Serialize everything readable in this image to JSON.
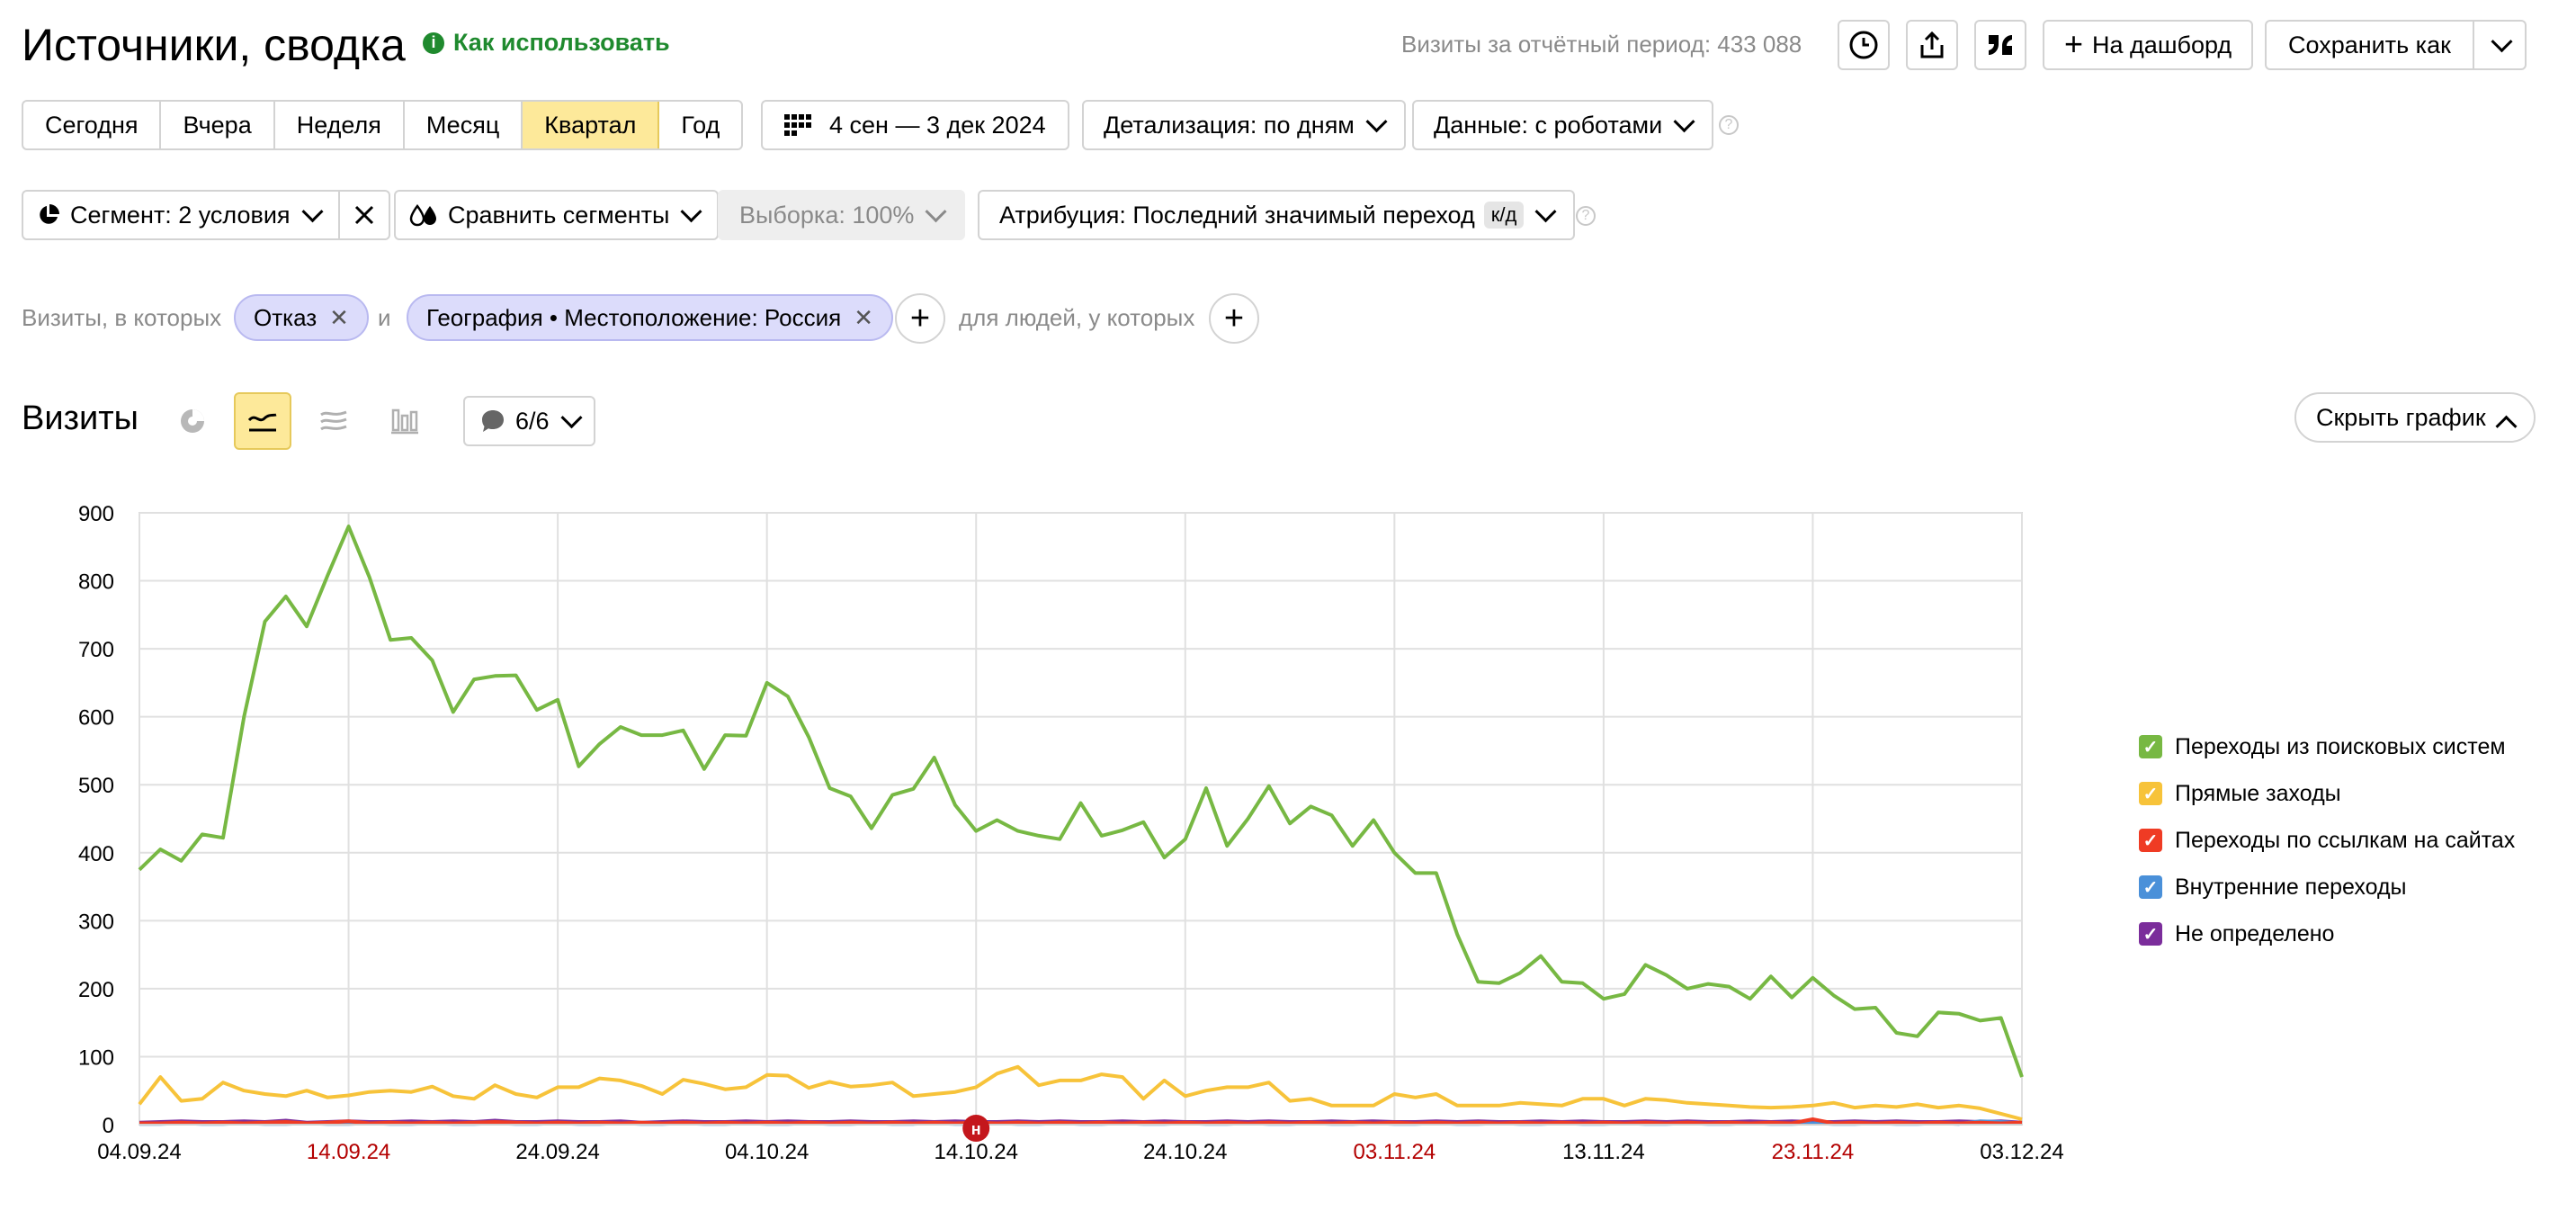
{
  "header": {
    "title": "Источники, сводка",
    "help_link": "Как использовать",
    "visits_summary": "Визиты за отчётный период: 433 088",
    "to_dashboard": "На дашборд",
    "save_as": "Сохранить как"
  },
  "periods": [
    {
      "label": "Сегодня",
      "active": false
    },
    {
      "label": "Вчера",
      "active": false
    },
    {
      "label": "Неделя",
      "active": false
    },
    {
      "label": "Месяц",
      "active": false
    },
    {
      "label": "Квартал",
      "active": true
    },
    {
      "label": "Год",
      "active": false
    }
  ],
  "date_range": "4 сен — 3 дек 2024",
  "detail": "Детализация: по дням",
  "data_mode": "Данные: с роботами",
  "segment": "Сегмент: 2 условия",
  "compare": "Сравнить сегменты",
  "sample": "Выборка: 100%",
  "attribution": "Атрибуция: Последний значимый переход",
  "attribution_badge": "к/д",
  "filters": {
    "prefix": "Визиты, в которых",
    "chip1": "Отказ",
    "conj": "и",
    "chip2": "География • Местоположение: Россия",
    "people": "для людей, у которых"
  },
  "chart_header": {
    "title": "Визиты",
    "series_count": "6/6",
    "hide": "Скрыть график"
  },
  "colors": {
    "accent": "#fde99a",
    "search": "#77b843",
    "direct": "#f7c33a",
    "links": "#ef3b24",
    "internal": "#4a90d9",
    "undefined": "#7b2d9b",
    "weekend": "#b30000"
  },
  "chart_data": {
    "type": "line",
    "ylim": [
      0,
      900
    ],
    "yticks": [
      0,
      100,
      200,
      300,
      400,
      500,
      600,
      700,
      800,
      900
    ],
    "xticks": [
      {
        "label": "04.09.24",
        "weekend": false
      },
      {
        "label": "14.09.24",
        "weekend": true
      },
      {
        "label": "24.09.24",
        "weekend": false
      },
      {
        "label": "04.10.24",
        "weekend": false
      },
      {
        "label": "14.10.24",
        "weekend": false
      },
      {
        "label": "24.10.24",
        "weekend": false
      },
      {
        "label": "03.11.24",
        "weekend": true
      },
      {
        "label": "13.11.24",
        "weekend": false
      },
      {
        "label": "23.11.24",
        "weekend": true
      },
      {
        "label": "03.12.24",
        "weekend": false
      }
    ],
    "marker": {
      "label": "н",
      "day_index": 40
    },
    "series": [
      {
        "name": "Переходы из поисковых систем",
        "color": "#77b843",
        "values": [
          375,
          405,
          388,
          427,
          422,
          600,
          740,
          777,
          733,
          808,
          880,
          805,
          713,
          716,
          683,
          607,
          655,
          660,
          661,
          610,
          625,
          527,
          560,
          585,
          573,
          573,
          580,
          523,
          573,
          572,
          650,
          630,
          570,
          495,
          483,
          436,
          485,
          494,
          540,
          470,
          432,
          448,
          432,
          425,
          420,
          473,
          425,
          433,
          445,
          393,
          420,
          495,
          410,
          450,
          498,
          443,
          468,
          455,
          410,
          448,
          400,
          370,
          370,
          280,
          210,
          208,
          223,
          248,
          210,
          208,
          185,
          192,
          235,
          220,
          200,
          207,
          203,
          185,
          218,
          187,
          216,
          190,
          170,
          172,
          135,
          130,
          165,
          163,
          153,
          157,
          70
        ]
      },
      {
        "name": "Прямые заходы",
        "color": "#f7c33a",
        "values": [
          30,
          70,
          35,
          38,
          62,
          50,
          45,
          42,
          50,
          40,
          43,
          48,
          50,
          48,
          56,
          42,
          38,
          58,
          45,
          40,
          55,
          55,
          68,
          65,
          57,
          45,
          66,
          60,
          52,
          55,
          73,
          72,
          54,
          63,
          56,
          58,
          62,
          42,
          45,
          48,
          55,
          75,
          85,
          58,
          65,
          65,
          74,
          70,
          38,
          65,
          42,
          50,
          55,
          55,
          62,
          35,
          38,
          28,
          28,
          28,
          45,
          40,
          45,
          28,
          28,
          28,
          32,
          30,
          28,
          38,
          38,
          28,
          38,
          36,
          32,
          30,
          28,
          26,
          25,
          26,
          28,
          32,
          25,
          28,
          26,
          30,
          25,
          28,
          24,
          16,
          8
        ]
      },
      {
        "name": "Переходы по ссылкам на сайтах",
        "color": "#ef3b24",
        "values": [
          2,
          2,
          3,
          2,
          3,
          2,
          3,
          4,
          2,
          3,
          5,
          2,
          3,
          2,
          3,
          2,
          3,
          4,
          3,
          2,
          3,
          2,
          3,
          2,
          3,
          2,
          3,
          2,
          3,
          2,
          3,
          2,
          3,
          2,
          3,
          2,
          3,
          2,
          3,
          2,
          3,
          2,
          3,
          2,
          3,
          2,
          3,
          2,
          3,
          2,
          3,
          2,
          3,
          2,
          3,
          2,
          3,
          2,
          3,
          2,
          3,
          2,
          3,
          2,
          3,
          2,
          3,
          2,
          3,
          2,
          3,
          2,
          3,
          2,
          3,
          2,
          3,
          2,
          3,
          2,
          8,
          2,
          3,
          2,
          3,
          2,
          3,
          2,
          3,
          2,
          3
        ]
      },
      {
        "name": "Внутренние переходы",
        "color": "#4a90d9",
        "values": [
          1,
          1,
          2,
          1,
          1,
          2,
          1,
          1,
          2,
          1,
          1,
          2,
          1,
          1,
          2,
          1,
          1,
          2,
          1,
          1,
          2,
          1,
          1,
          2,
          1,
          1,
          2,
          1,
          1,
          2,
          1,
          1,
          2,
          1,
          1,
          2,
          1,
          1,
          2,
          1,
          1,
          2,
          1,
          1,
          2,
          1,
          1,
          2,
          1,
          1,
          2,
          1,
          1,
          2,
          1,
          1,
          2,
          1,
          1,
          2,
          1,
          1,
          2,
          1,
          1,
          2,
          1,
          1,
          2,
          1,
          1,
          2,
          1,
          1,
          2,
          1,
          1,
          2,
          1,
          1,
          2,
          1,
          1,
          2,
          1,
          1,
          2,
          1,
          5,
          4,
          2
        ]
      },
      {
        "name": "Не определено",
        "color": "#7b2d9b",
        "values": [
          3,
          4,
          5,
          4,
          4,
          5,
          4,
          6,
          3,
          4,
          5,
          4,
          4,
          5,
          4,
          5,
          4,
          6,
          4,
          4,
          5,
          4,
          4,
          5,
          3,
          4,
          5,
          4,
          4,
          5,
          4,
          5,
          4,
          4,
          5,
          4,
          4,
          5,
          4,
          5,
          4,
          4,
          5,
          4,
          5,
          4,
          4,
          5,
          4,
          5,
          4,
          4,
          5,
          4,
          5,
          4,
          4,
          5,
          4,
          5,
          4,
          4,
          5,
          4,
          5,
          4,
          4,
          5,
          4,
          5,
          4,
          4,
          5,
          4,
          5,
          4,
          4,
          5,
          4,
          5,
          4,
          4,
          5,
          4,
          5,
          4,
          4,
          5,
          4,
          5,
          3
        ]
      }
    ]
  }
}
